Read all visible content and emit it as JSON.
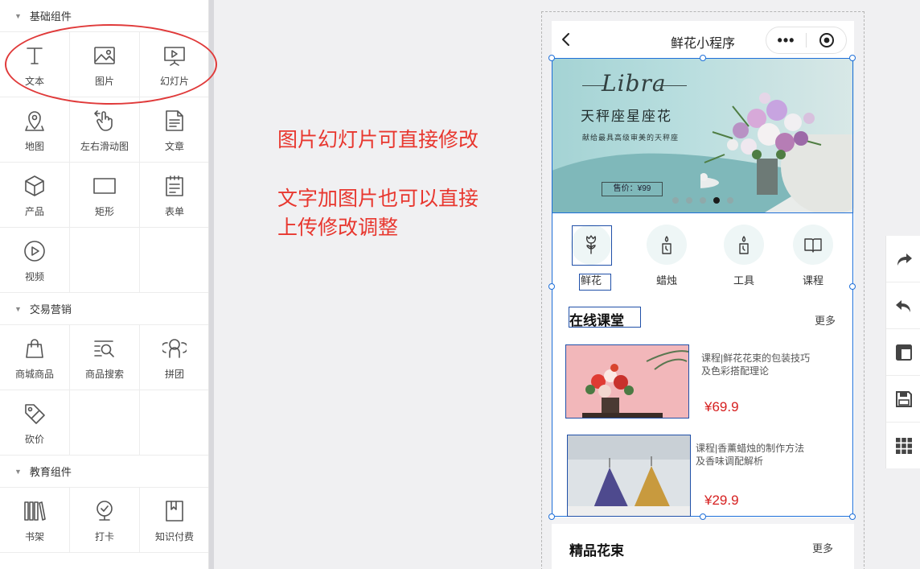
{
  "panel": {
    "sections": [
      {
        "title": "基础组件",
        "items": [
          {
            "label": "文本",
            "icon": "text-icon"
          },
          {
            "label": "图片",
            "icon": "image-icon"
          },
          {
            "label": "幻灯片",
            "icon": "slideshow-icon"
          },
          {
            "label": "地图",
            "icon": "map-pin-icon"
          },
          {
            "label": "左右滑动图",
            "icon": "swipe-hand-icon"
          },
          {
            "label": "文章",
            "icon": "article-icon"
          },
          {
            "label": "产品",
            "icon": "product-cube-icon"
          },
          {
            "label": "矩形",
            "icon": "rectangle-icon"
          },
          {
            "label": "表单",
            "icon": "form-icon"
          },
          {
            "label": "视频",
            "icon": "video-play-icon"
          }
        ]
      },
      {
        "title": "交易营销",
        "items": [
          {
            "label": "商城商品",
            "icon": "shopping-bag-icon"
          },
          {
            "label": "商品搜索",
            "icon": "product-search-icon"
          },
          {
            "label": "拼团",
            "icon": "group-buy-icon"
          },
          {
            "label": "砍价",
            "icon": "bargain-tag-icon"
          }
        ]
      },
      {
        "title": "教育组件",
        "items": [
          {
            "label": "书架",
            "icon": "bookshelf-icon"
          },
          {
            "label": "打卡",
            "icon": "check-in-badge-icon"
          },
          {
            "label": "知识付费",
            "icon": "paid-knowledge-icon"
          }
        ]
      }
    ]
  },
  "annotations": {
    "line1": "图片幻灯片可直接修改",
    "line2": "文字加图片也可以直接",
    "line3": "上传修改调整"
  },
  "phone": {
    "nav_title": "鲜花小程序",
    "capsule_more": "•••",
    "banner": {
      "script_text": "Libra",
      "headline": "天秤座星座花",
      "subline": "献给最具高级审美的天秤座",
      "price_tag": "售价：¥99",
      "slide_count": 5,
      "active_slide": 4
    },
    "categories": [
      {
        "label": "鲜花",
        "icon": "flower-icon"
      },
      {
        "label": "蜡烛",
        "icon": "candle-icon"
      },
      {
        "label": "工具",
        "icon": "tool-candle-icon"
      },
      {
        "label": "课程",
        "icon": "book-icon"
      }
    ],
    "online_class": {
      "title": "在线课堂",
      "more": "更多",
      "courses": [
        {
          "title_line1": "课程|鲜花花束的包装技巧",
          "title_line2": "及色彩搭配理论",
          "price": "¥69.9"
        },
        {
          "title_line1": "课程|香薰蜡烛的制作方法",
          "title_line2": "及香味调配解析",
          "price": "¥29.9"
        }
      ]
    },
    "bouquet": {
      "title": "精品花束",
      "more": "更多"
    }
  },
  "colors": {
    "annotation_red": "#e8372f",
    "price_red": "#d61f1f",
    "selection_blue": "#1e6fd9",
    "banner_teal": "#b9dedf"
  },
  "toolbar": {
    "tools": [
      "redo-icon",
      "undo-icon",
      "layout-icon",
      "save-icon",
      "apps-grid-icon"
    ]
  }
}
